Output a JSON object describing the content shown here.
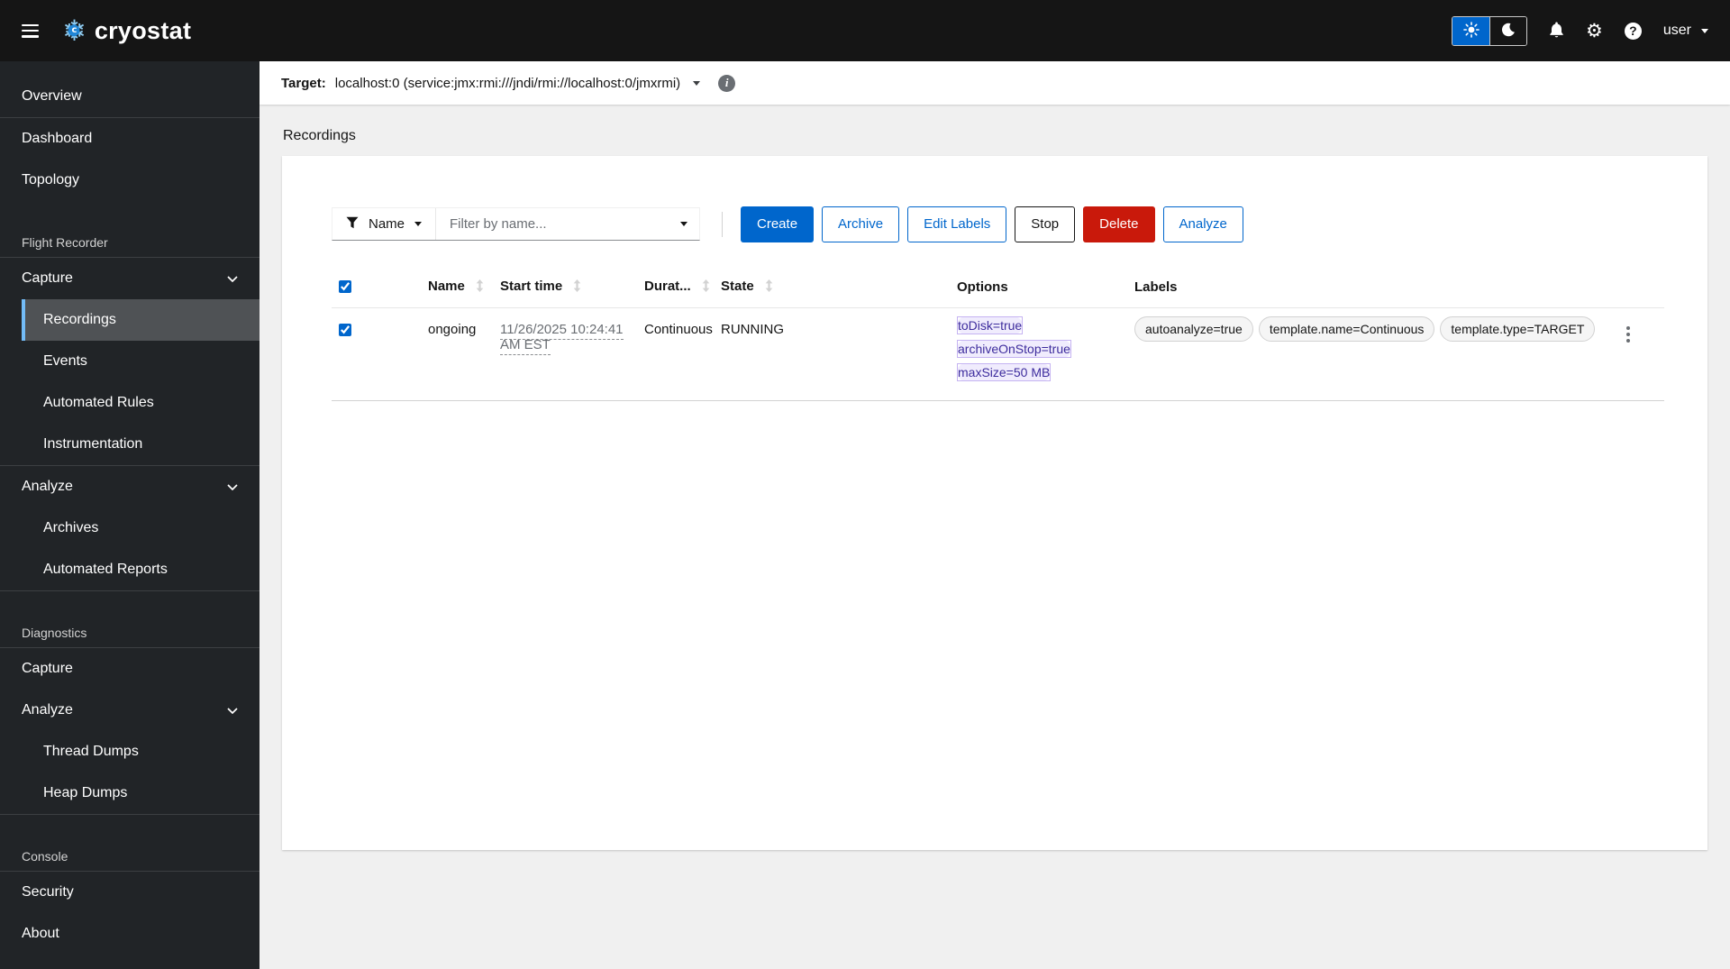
{
  "header": {
    "brand": "cryostat",
    "user": "user"
  },
  "sidebar": {
    "items": [
      {
        "label": "Overview",
        "type": "link"
      },
      {
        "label": "Dashboard",
        "type": "link"
      },
      {
        "label": "Topology",
        "type": "link"
      },
      {
        "label": "Flight Recorder",
        "type": "section"
      },
      {
        "label": "Capture",
        "type": "expandable"
      },
      {
        "label": "Recordings",
        "type": "sublink",
        "current": true
      },
      {
        "label": "Events",
        "type": "sublink"
      },
      {
        "label": "Automated Rules",
        "type": "sublink"
      },
      {
        "label": "Instrumentation",
        "type": "sublink"
      },
      {
        "label": "Analyze",
        "type": "expandable"
      },
      {
        "label": "Archives",
        "type": "sublink"
      },
      {
        "label": "Automated Reports",
        "type": "sublink"
      },
      {
        "label": "Diagnostics",
        "type": "section"
      },
      {
        "label": "Capture",
        "type": "link"
      },
      {
        "label": "Analyze",
        "type": "expandable"
      },
      {
        "label": "Thread Dumps",
        "type": "sublink"
      },
      {
        "label": "Heap Dumps",
        "type": "sublink"
      },
      {
        "label": "Console",
        "type": "section"
      },
      {
        "label": "Security",
        "type": "link"
      },
      {
        "label": "About",
        "type": "link"
      }
    ]
  },
  "target_bar": {
    "label": "Target:",
    "value": "localhost:0 (service:jmx:rmi:///jndi/rmi://localhost:0/jmxrmi)"
  },
  "main": {
    "title": "Recordings",
    "toolbar": {
      "filter_attribute": "Name",
      "filter_placeholder": "Filter by name...",
      "buttons": [
        {
          "label": "Create",
          "variant": "primary"
        },
        {
          "label": "Archive",
          "variant": "secondary"
        },
        {
          "label": "Edit Labels",
          "variant": "secondary"
        },
        {
          "label": "Stop",
          "variant": "control"
        },
        {
          "label": "Delete",
          "variant": "danger"
        },
        {
          "label": "Analyze",
          "variant": "secondary"
        }
      ]
    },
    "table": {
      "columns": [
        "Name",
        "Start time",
        "Durat...",
        "State",
        "Options",
        "Labels"
      ],
      "rows": [
        {
          "name": "ongoing",
          "start_time": "11/26/2025 10:24:41 AM EST",
          "duration": "Continuous",
          "state": "RUNNING",
          "options": [
            "toDisk=true",
            "archiveOnStop=true",
            "maxSize=50 MB"
          ],
          "labels": [
            "autoanalyze=true",
            "template.name=Continuous",
            "template.type=TARGET"
          ]
        }
      ]
    }
  },
  "colors": {
    "primary": "#0066cc",
    "danger": "#c9190b",
    "masthead_bg": "#151515",
    "sidebar_bg": "#212427",
    "active_indicator": "#73bcf7",
    "option_chip_bg": "#f0ecfd",
    "option_chip_text": "#3d2c9d",
    "label_chip_bg": "#f5f5f5"
  }
}
